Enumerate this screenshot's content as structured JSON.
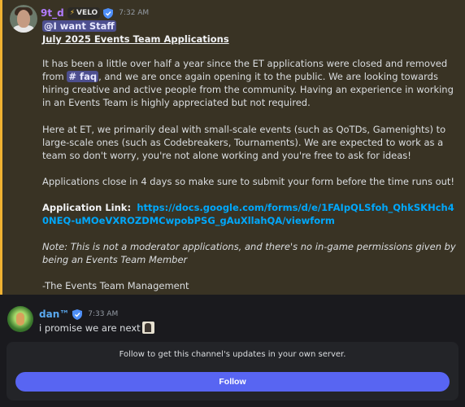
{
  "messages": [
    {
      "username": "9t_d",
      "tag": "VELO",
      "time": "7:32 AM",
      "mention": "@I want Staff",
      "title": "July 2025 Events Team Applications",
      "para1_a": "It has been a little over half a year since the ET applications were closed and removed from ",
      "para1_channel": "# faq",
      "para1_b": ", and we are once again opening it to the public. We are looking towards hiring creative and active people from the community. Having an experience in working in an Events Team is highly appreciated but not required.",
      "para2": "Here at ET, we primarily deal with small-scale events (such as QoTDs, Gamenights) to large-scale ones (such as Codebreakers, Tournaments). We are expected to work as a team so don't worry, you're not alone working and you're free to ask for ideas!",
      "para3": "Applications close in 4 days so make sure to submit your form before the time runs out!",
      "link_label": "Application Link:",
      "link_url": "https://docs.google.com/forms/d/e/1FAIpQLSfoh_QhkSKHch40NEQ-uMOeVXROZDMCwpobPSG_gAuXllahQA/viewform",
      "note": "Note: This is not a moderator applications, and there's no in-game permissions given by being an Events Team Member",
      "signature": "-The Events Team Management"
    },
    {
      "username": "dan™",
      "time": "7:33 AM",
      "text": "i promise we are next"
    }
  ],
  "follow_panel": {
    "text": "Follow to get this channel's updates in your own server.",
    "button_label": "Follow"
  },
  "colors": {
    "highlight_bg": "#393324",
    "highlight_border": "#f0b232",
    "username1": "#b17bff",
    "username2": "#5aa9f0",
    "link": "#00a8fc",
    "button": "#5865f2"
  }
}
